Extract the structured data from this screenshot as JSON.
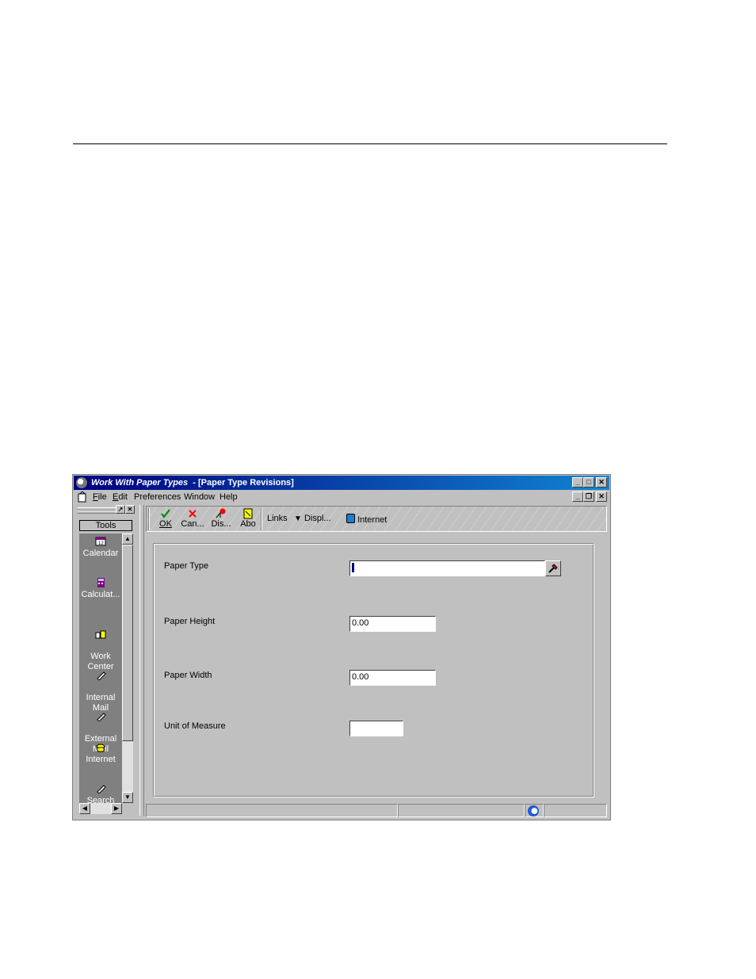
{
  "window": {
    "title_italic": "Work With Paper Types",
    "title_rest": "  - [Paper Type Revisions]"
  },
  "menu": {
    "file": "File",
    "edit": "Edit",
    "preferences": "Preferences",
    "window": "Window",
    "help": "Help"
  },
  "tools": {
    "header": "Tools",
    "items": [
      {
        "label": "Calendar",
        "icon": "calendar-icon"
      },
      {
        "label": "Calculat...",
        "icon": "calculator-icon"
      },
      {
        "label": "Work\nCenter",
        "icon": "work-center-icon"
      },
      {
        "label": "Internal\nMail",
        "icon": "internal-mail-icon"
      },
      {
        "label": "External\nMail",
        "icon": "external-mail-icon"
      },
      {
        "label": "Internet",
        "icon": "internet-icon"
      },
      {
        "label": "Search",
        "icon": "search-icon"
      }
    ]
  },
  "toolbar": {
    "ok": "OK",
    "cancel": "Can...",
    "display": "Dis...",
    "about": "Abo",
    "links": "Links",
    "displ": "Displ...",
    "internet": "Internet"
  },
  "form": {
    "paper_type": {
      "label": "Paper Type",
      "value": ""
    },
    "paper_height": {
      "label": "Paper Height",
      "value": "0.00"
    },
    "paper_width": {
      "label": "Paper Width",
      "value": "0.00"
    },
    "unit_of_measure": {
      "label": "Unit of Measure",
      "value": ""
    }
  },
  "colors": {
    "titlebar_start": "#000080",
    "titlebar_end": "#1084d0",
    "face": "#c0c0c0"
  }
}
